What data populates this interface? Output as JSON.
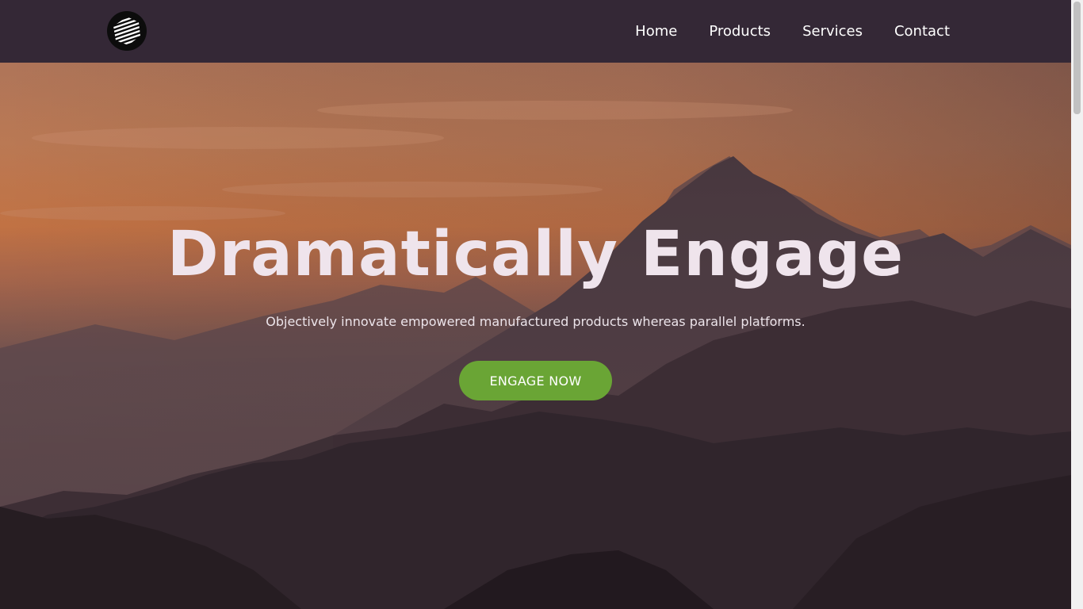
{
  "header": {
    "logo_icon": "striped-circle-logo-icon",
    "nav": [
      {
        "label": "Home"
      },
      {
        "label": "Products"
      },
      {
        "label": "Services"
      },
      {
        "label": "Contact"
      }
    ]
  },
  "hero": {
    "title": "Dramatically Engage",
    "subtitle": "Objectively innovate empowered manufactured products whereas parallel platforms.",
    "cta_label": "ENGAGE NOW",
    "background_image": "mountain-sunset-image"
  },
  "colors": {
    "header_bg": "#342836",
    "cta_bg": "#6aa535",
    "text_light": "#efe4ec"
  }
}
